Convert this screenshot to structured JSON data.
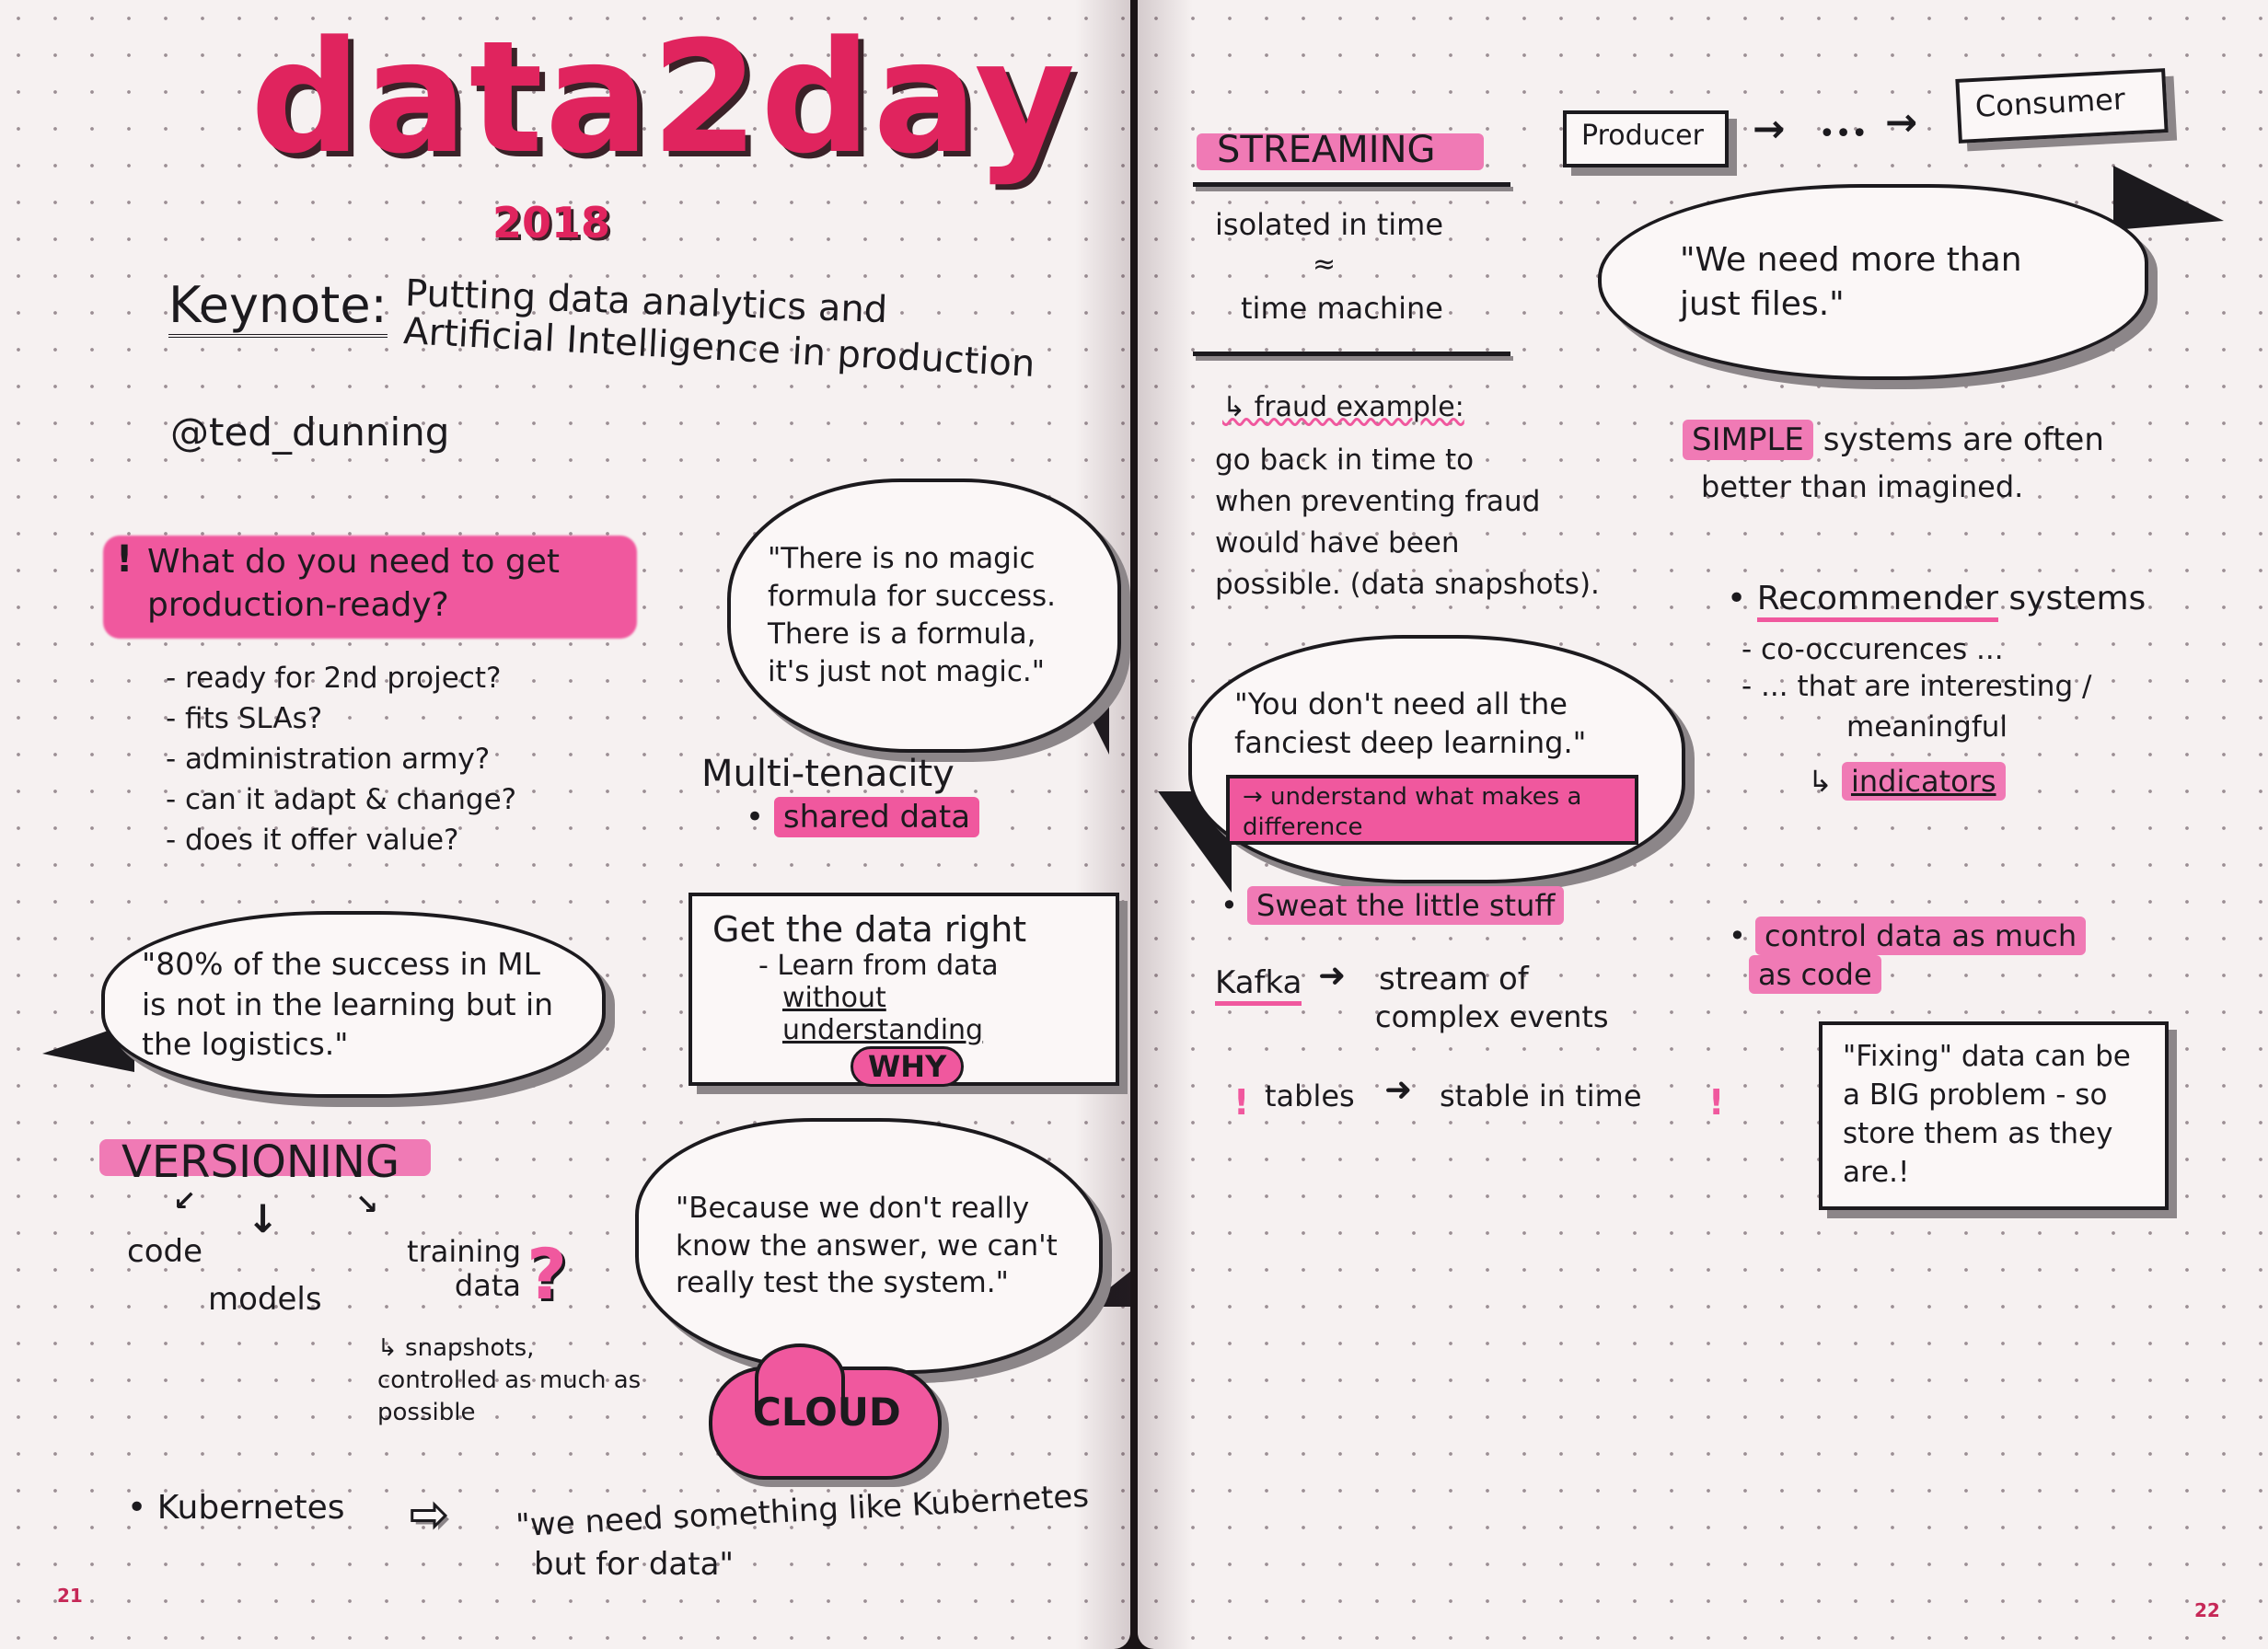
{
  "left": {
    "title": "data2day",
    "year": "2018",
    "keynote_label": "Keynote:",
    "keynote_line1": "Putting data analytics and",
    "keynote_line2": "Artificial Intelligence in production",
    "speaker": "@ted_dunning",
    "question_mark": "!",
    "question": "What do you need to get production-ready?",
    "checklist": [
      "- ready for 2nd project?",
      "- fits SLAs?",
      "- administration army?",
      "- can it adapt & change?",
      "- does it offer value?"
    ],
    "quote_magic": "\"There is no magic formula for success. There is a formula, it's just not magic.\"",
    "multi_tenacity": "Multi-tenacity",
    "shared_data": "shared data",
    "quote_ml": "\"80% of the success in ML is not in the learning but in the logistics.\"",
    "data_right_title": "Get the data right",
    "data_right_line1": "- Learn from data",
    "data_right_line2": "without understanding",
    "why": "WHY",
    "versioning": "VERSIONING",
    "v_code": "code",
    "v_models": "models",
    "v_training": "training data",
    "v_snapshots": "↳ snapshots, controlled as much as possible",
    "quote_because": "\"Because we don't really know the answer, we can't really test the system.\"",
    "cloud": "CLOUD",
    "kubernetes": "Kubernetes",
    "quote_kube_1": "\"we need something like Kubernetes",
    "quote_kube_2": "but for data\"",
    "page_number": "21"
  },
  "right": {
    "streaming": "STREAMING",
    "isolated": "isolated in time",
    "approx": "≈",
    "time_machine": "time machine",
    "producer": "Producer",
    "dots": "•••",
    "consumer": "Consumer",
    "quote_files": "\"We need more than just files.\"",
    "fraud_title": "↳ fraud example:",
    "fraud_lines": [
      "go back in time to",
      "when preventing fraud",
      "would have been",
      "possible. (data snapshots)."
    ],
    "simple_word": "SIMPLE",
    "simple_rest": "systems are often",
    "simple_line2": "better than imagined.",
    "quote_deep": "\"You don't need all the fanciest deep learning.\"",
    "understand": "→ understand what makes a difference",
    "recommender": "Recommender",
    "recommender_rest": "systems",
    "co_occ": "- co-occurences ...",
    "interesting": "- ... that are interesting /",
    "meaningful": "meaningful",
    "indicators": "indicators",
    "sweat": "Sweat the little stuff",
    "kafka": "Kafka",
    "stream_of": "stream of",
    "complex_events": "complex events",
    "control": "control data as much",
    "as_code": "as code",
    "tables": "tables",
    "stable": "stable in time",
    "fixing": "\"Fixing\" data can be a BIG problem - so store them as they are.!",
    "page_number": "22"
  },
  "colors": {
    "highlight": "#f0589e",
    "title": "#e0245e",
    "ink": "#1c1a1e",
    "shadow": "#8c8689"
  }
}
